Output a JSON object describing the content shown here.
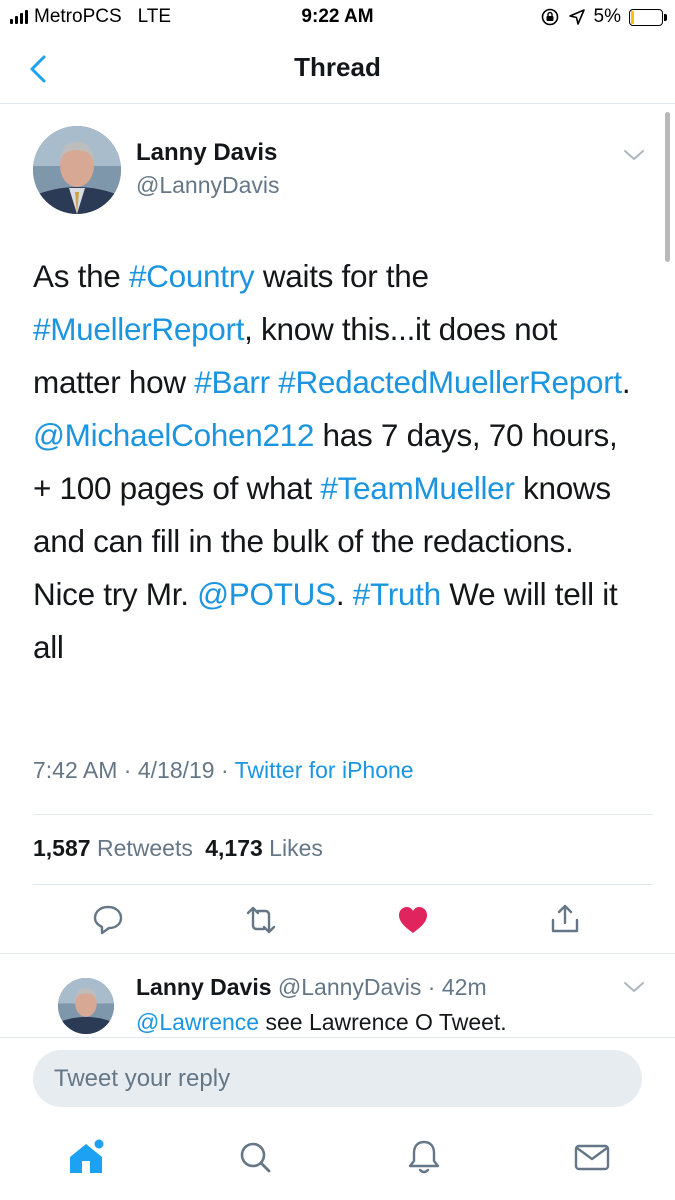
{
  "status_bar": {
    "carrier": "MetroPCS",
    "network": "LTE",
    "time": "9:22 AM",
    "battery": "5%",
    "battery_color": "#f5c400"
  },
  "nav": {
    "title": "Thread",
    "back_icon": "chevron-left-icon"
  },
  "tweet": {
    "author_name": "Lanny Davis",
    "author_handle": "@LannyDavis",
    "text_parts": [
      {
        "t": "As the ",
        "link": false
      },
      {
        "t": "#Country",
        "link": true
      },
      {
        "t": " waits for the ",
        "link": false
      },
      {
        "t": "#MuellerReport",
        "link": true
      },
      {
        "t": ", know this...it does not matter how ",
        "link": false
      },
      {
        "t": "#Barr",
        "link": true
      },
      {
        "t": " ",
        "link": false
      },
      {
        "t": "#RedactedMuellerReport",
        "link": true
      },
      {
        "t": ". ",
        "link": false
      },
      {
        "t": "@MichaelCohen212",
        "link": true
      },
      {
        "t": " has 7 days, 70 hours, + 100 pages of what ",
        "link": false
      },
      {
        "t": "#TeamMueller",
        "link": true
      },
      {
        "t": " knows and can fill in the bulk of the redactions. Nice try Mr. ",
        "link": false
      },
      {
        "t": "@POTUS",
        "link": true
      },
      {
        "t": ". ",
        "link": false
      },
      {
        "t": "#Truth",
        "link": true
      },
      {
        "t": " We will tell it all",
        "link": false
      }
    ],
    "time": "7:42 AM",
    "date": "4/18/19",
    "separator": " · ",
    "source": "Twitter for iPhone",
    "retweets_count": "1,587",
    "retweets_label": "Retweets",
    "likes_count": "4,173",
    "likes_label": "Likes",
    "liked": true,
    "like_color": "#e0245e",
    "link_color": "#1b95e0"
  },
  "reply": {
    "author_name": "Lanny Davis",
    "author_handle": "@LannyDavis",
    "time_ago": "42m",
    "mention": "@Lawrence",
    "text": " see Lawrence O Tweet."
  },
  "composer": {
    "placeholder": "Tweet your reply"
  },
  "tab_bar": {
    "items": [
      "home-icon",
      "search-icon",
      "notifications-icon",
      "messages-icon"
    ],
    "active": "home-icon",
    "active_color": "#1da1f2"
  }
}
